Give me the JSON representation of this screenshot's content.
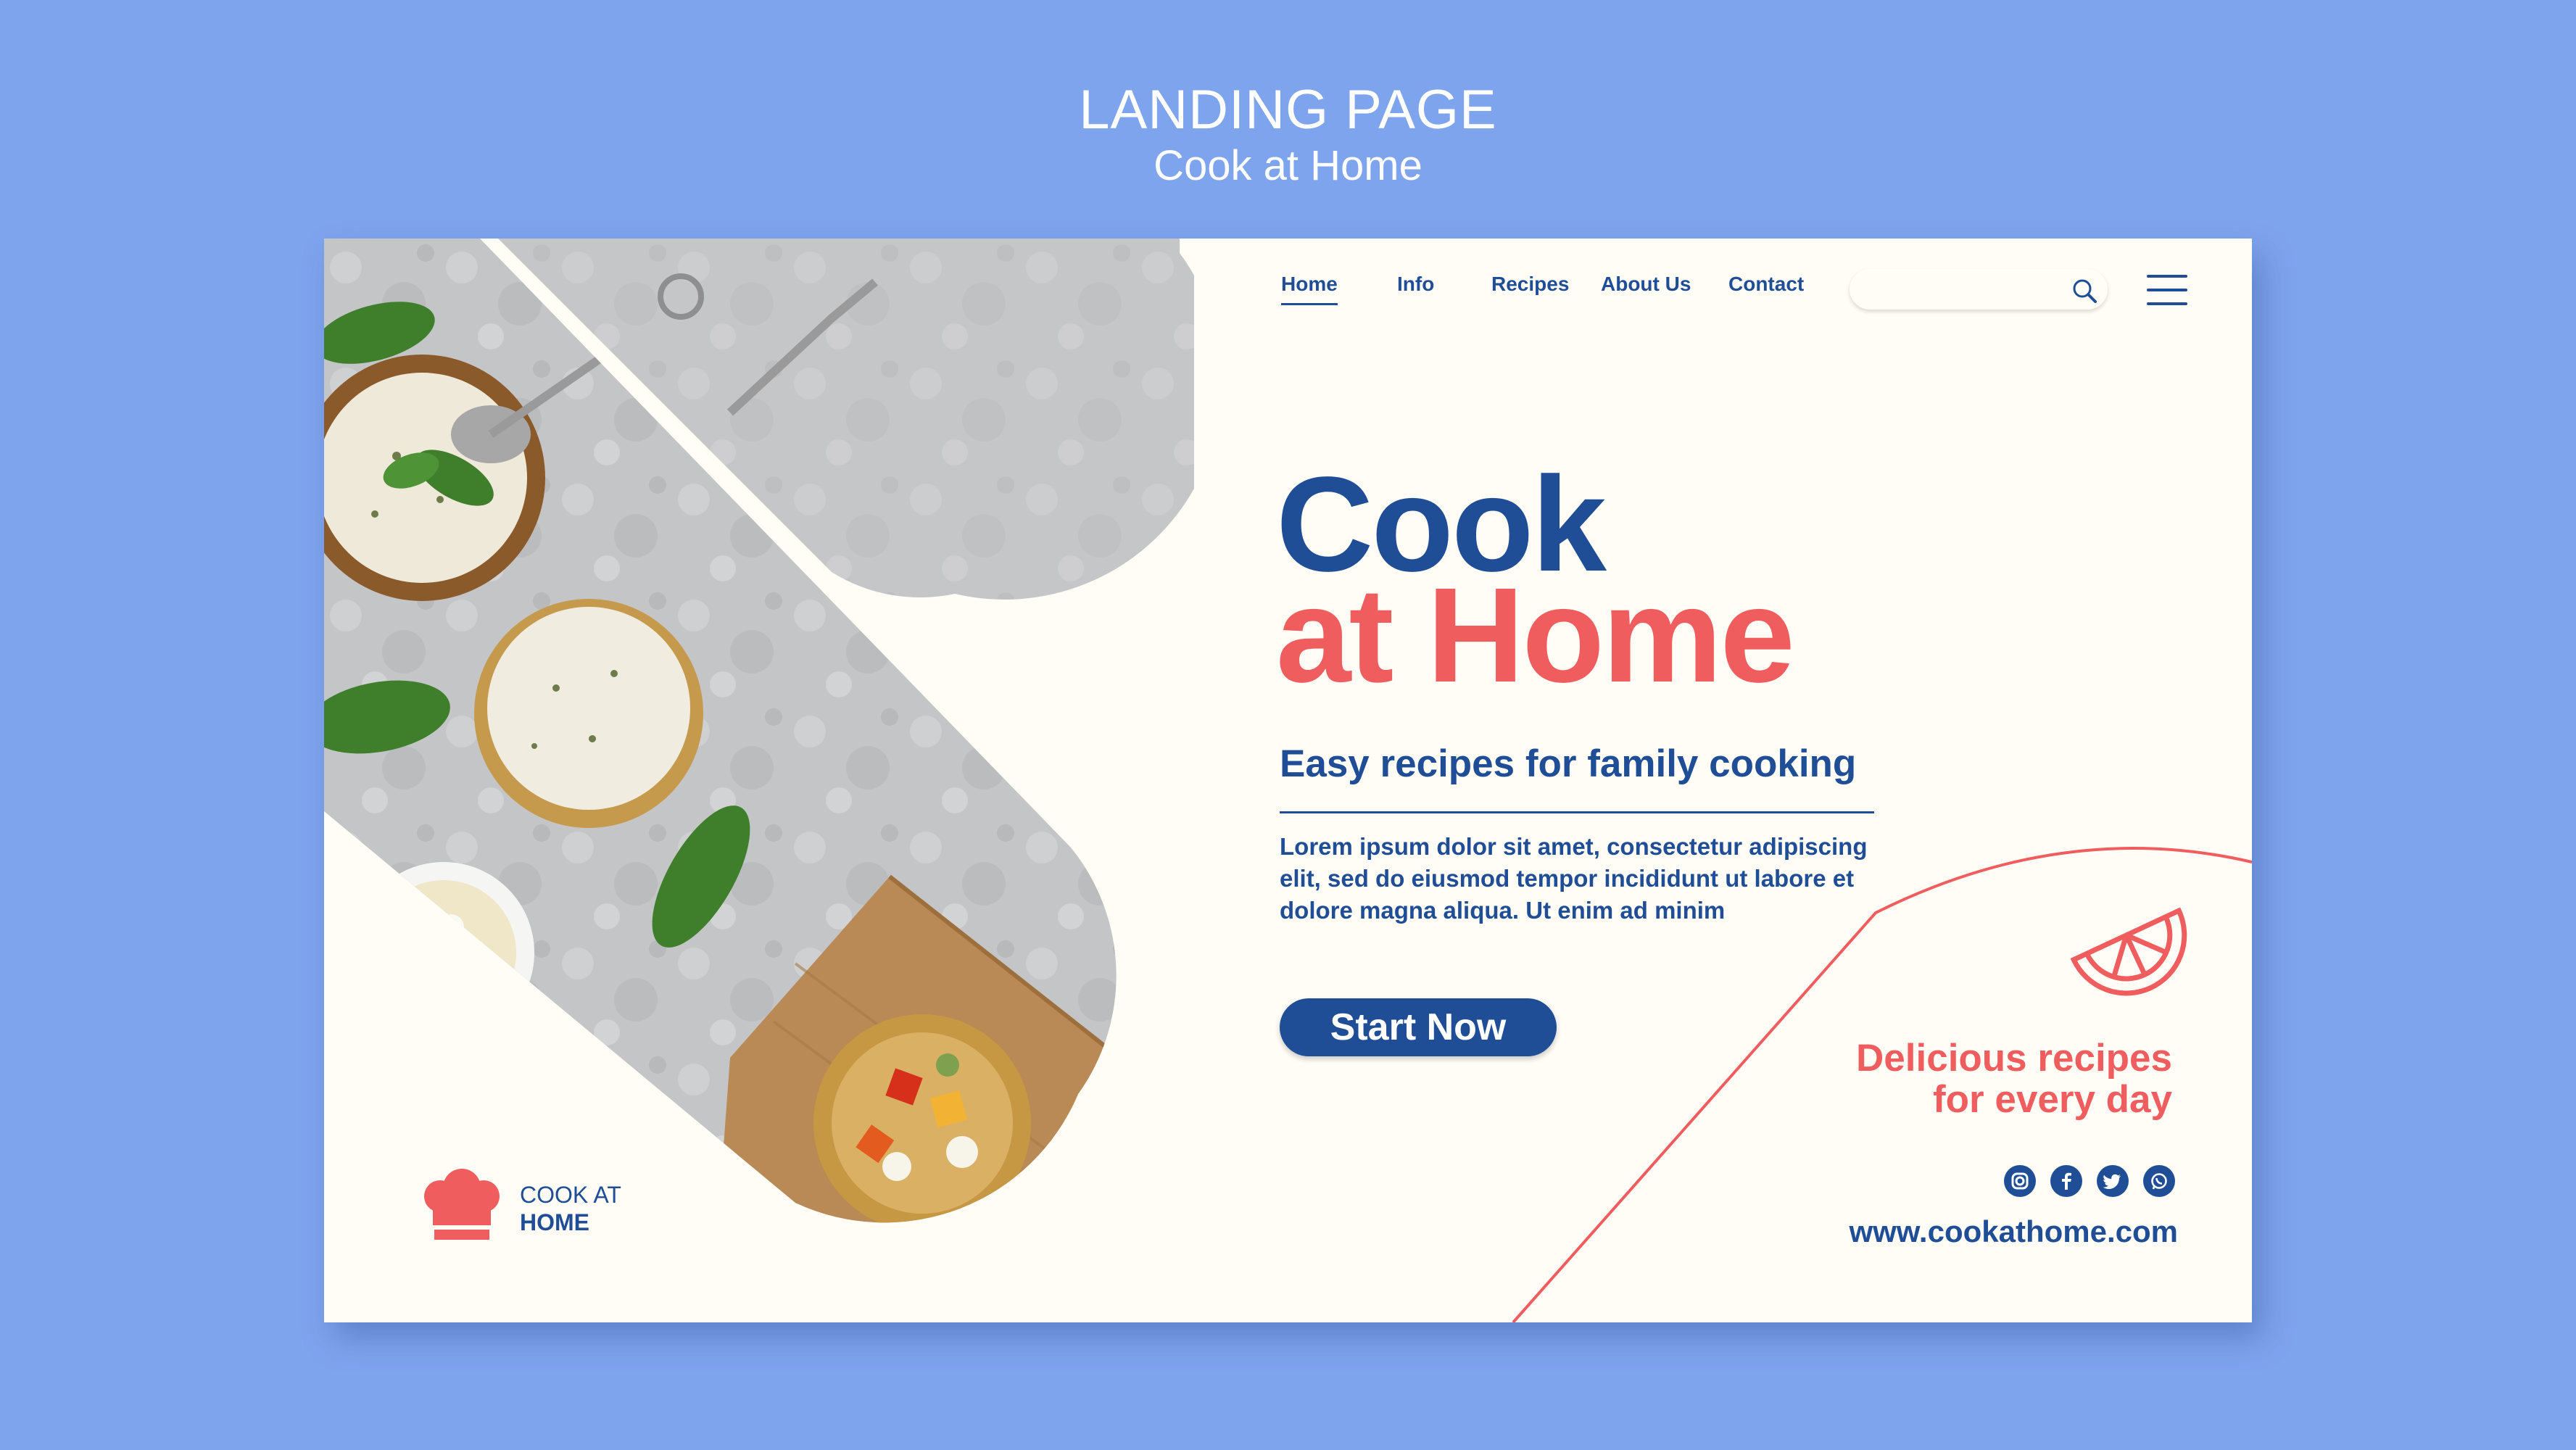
{
  "frame": {
    "title": "LANDING PAGE",
    "subtitle": "Cook at Home"
  },
  "nav": {
    "items": [
      {
        "label": "Home",
        "active": true
      },
      {
        "label": "Info",
        "active": false
      },
      {
        "label": "Recipes",
        "active": false
      },
      {
        "label": "About Us",
        "active": false
      },
      {
        "label": "Contact",
        "active": false
      }
    ],
    "search_placeholder": ""
  },
  "hero": {
    "line1": "Cook",
    "line2": "at Home",
    "subtitle": "Easy recipes for family cooking",
    "body": "Lorem ipsum dolor sit amet, consectetur adipiscing elit, sed do eiusmod tempor incididunt ut labore et dolore magna aliqua. Ut enim ad minim",
    "cta_label": "Start Now"
  },
  "tagline": {
    "line1": "Delicious recipes",
    "line2": "for every day"
  },
  "socials": [
    "instagram-icon",
    "facebook-icon",
    "twitter-icon",
    "whatsapp-icon"
  ],
  "website": "www.cookathome.com",
  "logo": {
    "line1": "COOK AT",
    "line2": "HOME"
  },
  "colors": {
    "background": "#7fa4ee",
    "card": "#fffdf6",
    "navy": "#1f4e96",
    "coral": "#f05d5e"
  }
}
